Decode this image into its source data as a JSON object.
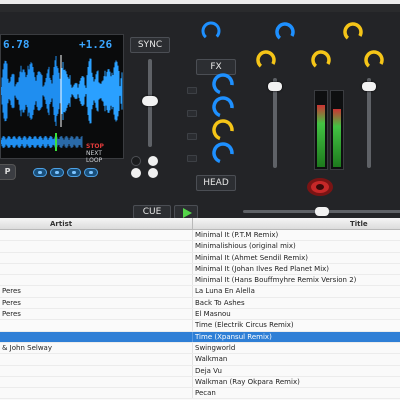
{
  "deck": {
    "tempo_left": "6.78",
    "tempo_right": "+1.26",
    "loop_stop": "STOP",
    "loop_next": "NEXT",
    "loop_loop": "LOOP",
    "stop_label": "P",
    "sync_label": "SYNC",
    "fx_label": "FX",
    "head_label": "HEAD",
    "cue_label": "CUE",
    "colors": {
      "accent_blue": "#3aa6ff",
      "knob_blue": "#1e90ff",
      "knob_yellow": "#f5c518",
      "vu_green": "#43c243",
      "record_red": "#c62828"
    }
  },
  "library": {
    "columns": {
      "artist": "Artist",
      "title": "Title"
    },
    "rows": [
      {
        "artist": "",
        "title": "Minimal It (P.T.M Remix)"
      },
      {
        "artist": "",
        "title": "Minimalishious (original mix)"
      },
      {
        "artist": "",
        "title": "Minimal It (Ahmet Sendil Remix)"
      },
      {
        "artist": "",
        "title": "Minimal It (Johan Ilves Red Planet Mix)"
      },
      {
        "artist": "",
        "title": "Minimal It (Hans Bouffmyhre Remix Version 2)"
      },
      {
        "artist": "Peres",
        "title": "La Luna En Alella"
      },
      {
        "artist": "Peres",
        "title": "Back To Ashes"
      },
      {
        "artist": "Peres",
        "title": "El Masnou"
      },
      {
        "artist": "",
        "title": "Time (Electrik Circus Remix)"
      },
      {
        "artist": "",
        "title": "Time (Xpansul Remix)",
        "selected": true
      },
      {
        "artist": "& John Selway",
        "title": "Swingworld"
      },
      {
        "artist": "",
        "title": "Walkman"
      },
      {
        "artist": "",
        "title": "Deja Vu"
      },
      {
        "artist": "",
        "title": "Walkman (Ray Okpara Remix)"
      },
      {
        "artist": "",
        "title": "Pecan"
      }
    ]
  }
}
